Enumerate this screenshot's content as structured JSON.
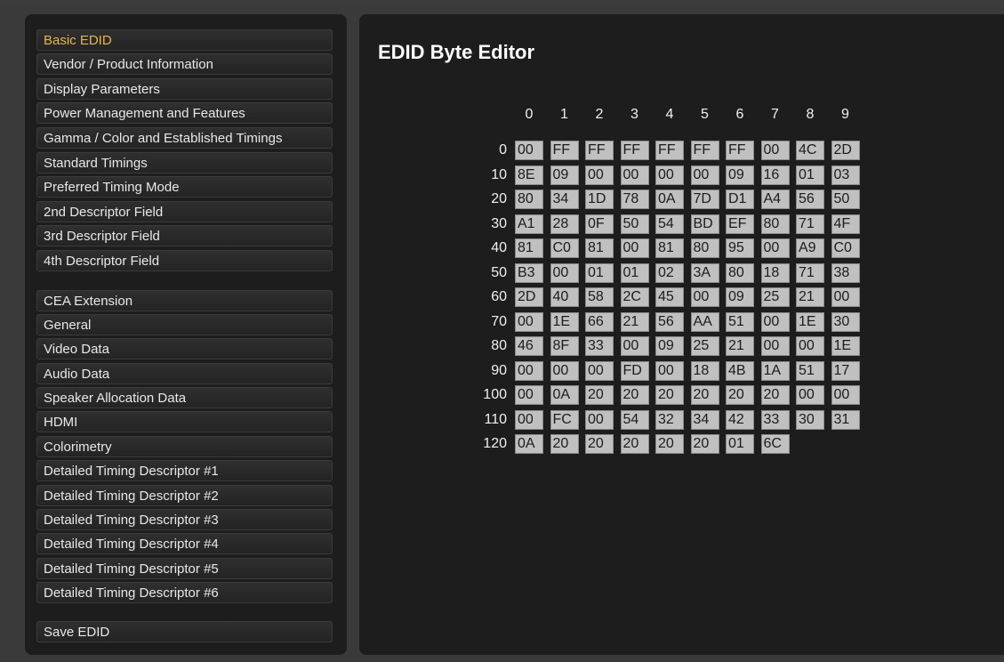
{
  "sidebar": {
    "items": [
      "Basic EDID",
      "Vendor / Product Information",
      "Display Parameters",
      "Power Management and Features",
      "Gamma / Color and Established Timings",
      "Standard Timings",
      "Preferred Timing Mode",
      "2nd Descriptor Field",
      "3rd Descriptor Field",
      "4th Descriptor Field",
      "CEA Extension",
      "General",
      "Video Data",
      "Audio Data",
      "Speaker Allocation Data",
      "HDMI",
      "Colorimetry",
      "Detailed Timing Descriptor #1",
      "Detailed Timing Descriptor #2",
      "Detailed Timing Descriptor #3",
      "Detailed Timing Descriptor #4",
      "Detailed Timing Descriptor #5",
      "Detailed Timing Descriptor #6",
      "Save EDID"
    ],
    "active_index": 0,
    "active_color": "#e3b64a"
  },
  "editor": {
    "title": "EDID Byte Editor",
    "column_headers": [
      "0",
      "1",
      "2",
      "3",
      "4",
      "5",
      "6",
      "7",
      "8",
      "9"
    ],
    "rows": [
      {
        "label": "0",
        "bytes": [
          "00",
          "FF",
          "FF",
          "FF",
          "FF",
          "FF",
          "FF",
          "00",
          "4C",
          "2D"
        ]
      },
      {
        "label": "10",
        "bytes": [
          "8E",
          "09",
          "00",
          "00",
          "00",
          "00",
          "09",
          "16",
          "01",
          "03"
        ]
      },
      {
        "label": "20",
        "bytes": [
          "80",
          "34",
          "1D",
          "78",
          "0A",
          "7D",
          "D1",
          "A4",
          "56",
          "50"
        ]
      },
      {
        "label": "30",
        "bytes": [
          "A1",
          "28",
          "0F",
          "50",
          "54",
          "BD",
          "EF",
          "80",
          "71",
          "4F"
        ]
      },
      {
        "label": "40",
        "bytes": [
          "81",
          "C0",
          "81",
          "00",
          "81",
          "80",
          "95",
          "00",
          "A9",
          "C0"
        ]
      },
      {
        "label": "50",
        "bytes": [
          "B3",
          "00",
          "01",
          "01",
          "02",
          "3A",
          "80",
          "18",
          "71",
          "38"
        ]
      },
      {
        "label": "60",
        "bytes": [
          "2D",
          "40",
          "58",
          "2C",
          "45",
          "00",
          "09",
          "25",
          "21",
          "00"
        ]
      },
      {
        "label": "70",
        "bytes": [
          "00",
          "1E",
          "66",
          "21",
          "56",
          "AA",
          "51",
          "00",
          "1E",
          "30"
        ]
      },
      {
        "label": "80",
        "bytes": [
          "46",
          "8F",
          "33",
          "00",
          "09",
          "25",
          "21",
          "00",
          "00",
          "1E"
        ]
      },
      {
        "label": "90",
        "bytes": [
          "00",
          "00",
          "00",
          "FD",
          "00",
          "18",
          "4B",
          "1A",
          "51",
          "17"
        ]
      },
      {
        "label": "100",
        "bytes": [
          "00",
          "0A",
          "20",
          "20",
          "20",
          "20",
          "20",
          "20",
          "00",
          "00"
        ]
      },
      {
        "label": "110",
        "bytes": [
          "00",
          "FC",
          "00",
          "54",
          "32",
          "34",
          "42",
          "33",
          "30",
          "31"
        ]
      },
      {
        "label": "120",
        "bytes": [
          "0A",
          "20",
          "20",
          "20",
          "20",
          "20",
          "01",
          "6C"
        ]
      }
    ]
  }
}
